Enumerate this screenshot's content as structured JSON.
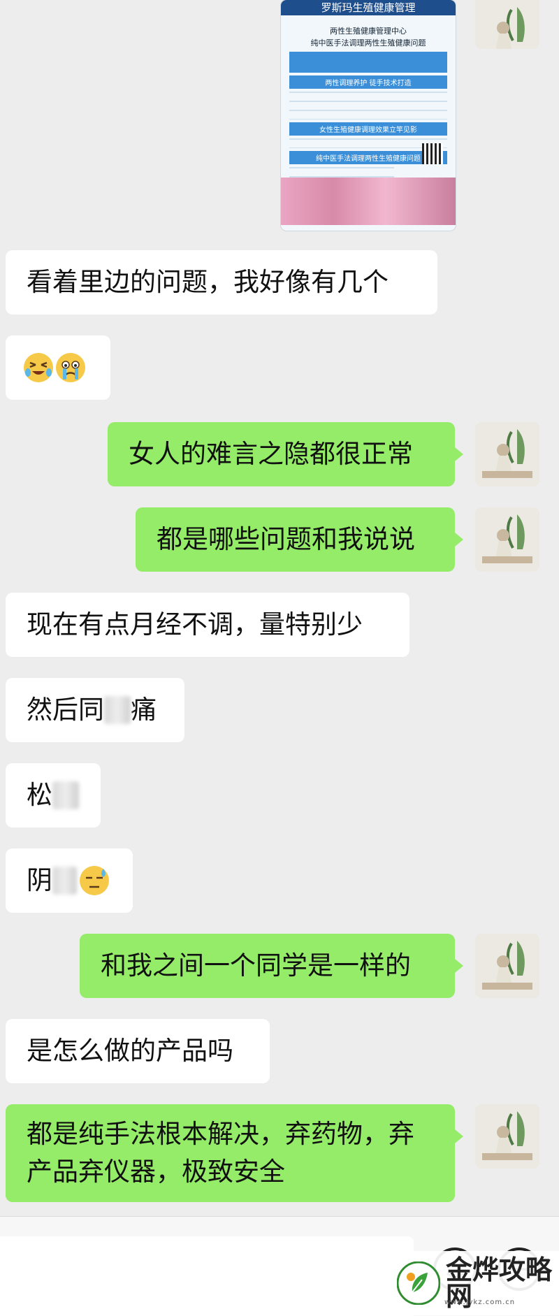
{
  "poster": {
    "title": "罗斯玛生殖健康管理",
    "line1": "两性生殖健康管理中心",
    "line2": "纯中医手法调理两性生殖健康问题",
    "banner1": "两性调理养护 徒手技术打造",
    "banner2": "女性生殖健康调理效果立竿见影",
    "banner3": "纯中医手法调理两性生殖健康问题"
  },
  "messages": [
    {
      "side": "left",
      "text": "看着里边的问题，我好像有几个"
    },
    {
      "side": "left",
      "text": "",
      "emoji": [
        "laughing-crying-emoji",
        "crying-emoji"
      ]
    },
    {
      "side": "right",
      "text": "女人的难言之隐都很正常"
    },
    {
      "side": "right",
      "text": "都是哪些问题和我说说"
    },
    {
      "side": "left",
      "text": "现在有点月经不调，量特别少"
    },
    {
      "side": "left",
      "text_before": "然后同",
      "text_after": "痛"
    },
    {
      "side": "left",
      "text_before": "松"
    },
    {
      "side": "left",
      "text_before": "阴",
      "emoji": [
        "sweat-emoji"
      ]
    },
    {
      "side": "right",
      "text": "和我之间一个同学是一样的"
    },
    {
      "side": "left",
      "text": "是怎么做的产品吗"
    },
    {
      "side": "right",
      "text": "都是纯手法根本解决，弃药物，弃产品弃仪器，极致安全"
    }
  ],
  "watermark": {
    "text": "金烨攻略网",
    "sub": "www.jykz.com.cn"
  },
  "colors": {
    "background": "#ededed",
    "right_bubble": "#95ec69",
    "left_bubble": "#ffffff"
  }
}
